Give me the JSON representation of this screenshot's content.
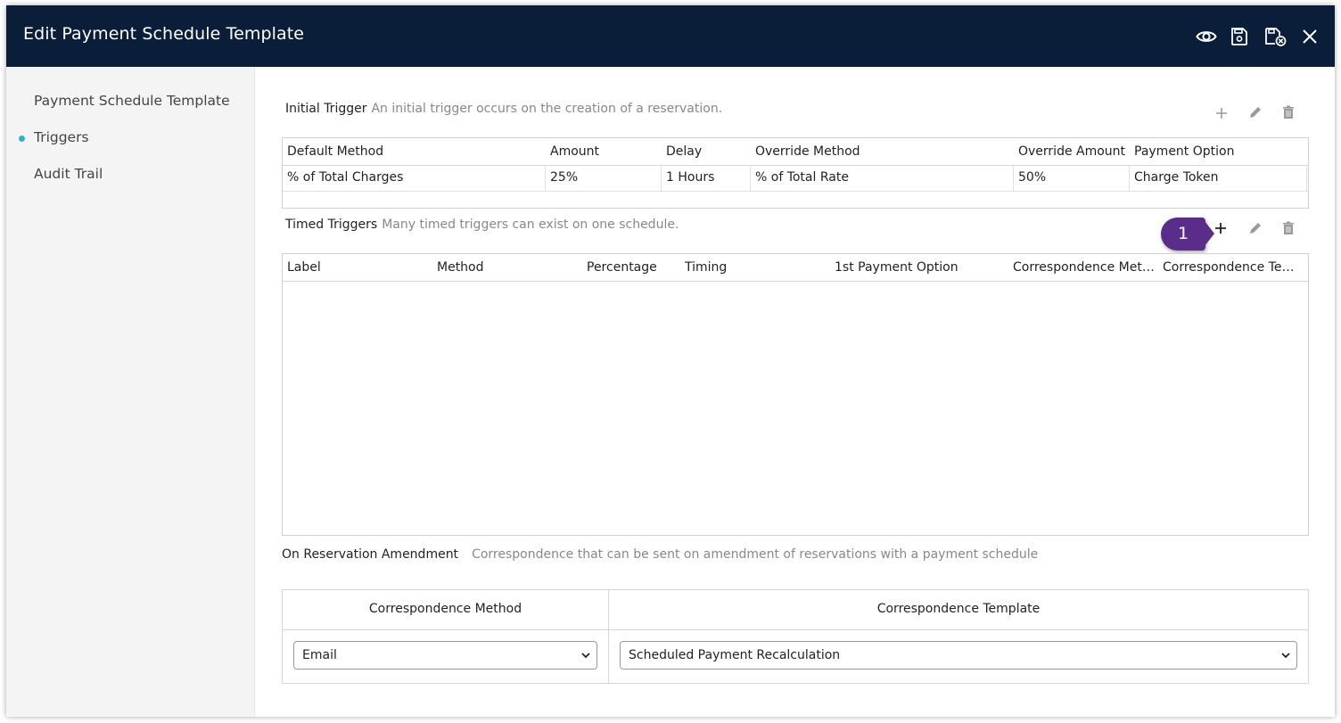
{
  "window": {
    "title": "Edit Payment Schedule Template"
  },
  "toolbar": {
    "icons": [
      "preview-eye-icon",
      "save-icon",
      "save-and-close-icon",
      "close-icon"
    ]
  },
  "sidebar": {
    "items": [
      {
        "label": "Payment Schedule Template",
        "active": false
      },
      {
        "label": "Triggers",
        "active": true
      },
      {
        "label": "Audit Trail",
        "active": false
      }
    ],
    "active_color": "#29b6c6"
  },
  "initial_trigger": {
    "heading": "Initial Trigger",
    "description": "An initial trigger occurs on the creation of a reservation.",
    "columns": [
      "Default Method",
      "Amount",
      "Delay",
      "Override Method",
      "Override Amount",
      "Payment Option"
    ],
    "rows": [
      [
        "% of Total Charges",
        "25%",
        "1 Hours",
        "% of Total Rate",
        "50%",
        "Charge Token"
      ]
    ]
  },
  "timed_triggers": {
    "heading": "Timed Triggers",
    "description": "Many timed triggers can exist on one schedule.",
    "columns": [
      "Label",
      "Method",
      "Percentage",
      "Timing",
      "1st Payment Option",
      "Correspondence Meth...",
      "Correspondence Tem..."
    ],
    "rows": []
  },
  "callout": {
    "number": "1",
    "color": "#5a2d8a"
  },
  "amendment": {
    "heading": "On Reservation Amendment",
    "description": "Correspondence that can be sent on amendment of reservations with a payment schedule",
    "col_method": "Correspondence Method",
    "col_template": "Correspondence Template",
    "method_value": "Email",
    "template_value": "Scheduled Payment Recalculation"
  },
  "colors": {
    "titlebar": "#0a1e3a",
    "sidebar": "#f4f4f4"
  }
}
